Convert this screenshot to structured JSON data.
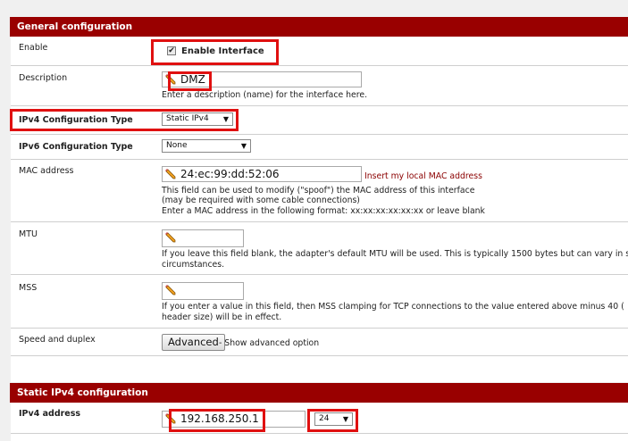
{
  "general": {
    "header": "General configuration",
    "enable": {
      "label": "Enable",
      "checkbox_label": "Enable Interface",
      "checked": true
    },
    "description": {
      "label": "Description",
      "value": "DMZ",
      "help": "Enter a description (name) for the interface here."
    },
    "ipv4_type": {
      "label": "IPv4 Configuration Type",
      "value": "Static IPv4"
    },
    "ipv6_type": {
      "label": "IPv6 Configuration Type",
      "value": "None"
    },
    "mac": {
      "label": "MAC address",
      "value": "24:ec:99:dd:52:06",
      "link": "Insert my local MAC address",
      "help1": "This field can be used to modify (\"spoof\") the MAC address of this interface",
      "help2": "(may be required with some cable connections)",
      "help3": "Enter a MAC address in the following format: xx:xx:xx:xx:xx:xx or leave blank"
    },
    "mtu": {
      "label": "MTU",
      "value": "",
      "help1": "If you leave this field blank, the adapter's default MTU will be used. This is typically 1500 bytes but can vary in s",
      "help2": "circumstances."
    },
    "mss": {
      "label": "MSS",
      "value": "",
      "help1": "If you enter a value in this field, then MSS clamping for TCP connections to the value entered above minus 40 (",
      "help2": "header size) will be in effect."
    },
    "speed": {
      "label": "Speed and duplex",
      "button": "Advanced",
      "suffix": "- Show advanced option"
    }
  },
  "static_ipv4": {
    "header": "Static IPv4 configuration",
    "address": {
      "label": "IPv4 address",
      "value": "192.168.250.1",
      "mask": "24"
    }
  },
  "colors": {
    "header_bg": "#990000",
    "highlight": "#e01010",
    "link": "#8b0000"
  }
}
